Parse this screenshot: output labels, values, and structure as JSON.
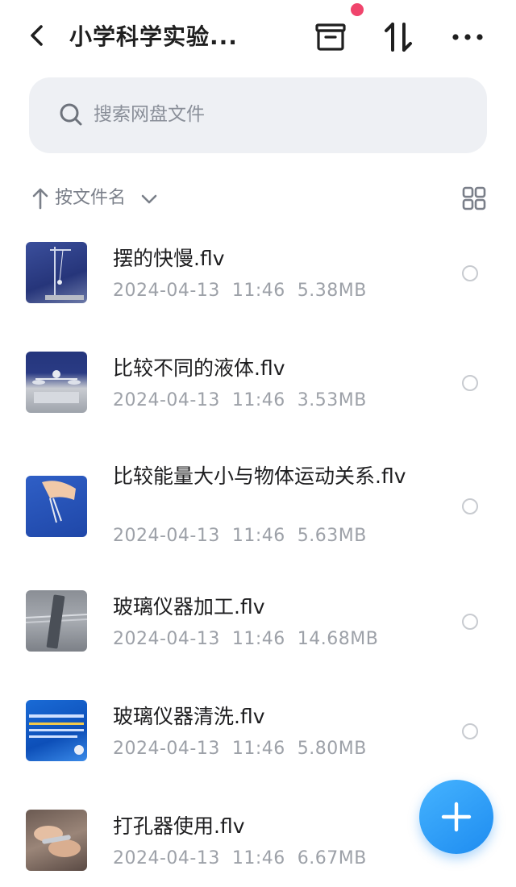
{
  "header": {
    "title": "小学科学实验...",
    "back_icon": "chevron-left-icon",
    "archive_icon": "archive-icon",
    "sort_icon": "sort-arrows-icon",
    "more_icon": "more-horizontal-icon",
    "badge_color": "#f0446c"
  },
  "search": {
    "placeholder": "搜索网盘文件"
  },
  "sort_bar": {
    "label": "按文件名",
    "view_icon": "grid-view-icon"
  },
  "files": [
    {
      "name": "摆的快慢.flv",
      "date": "2024-04-13",
      "time": "11:46",
      "size": "5.38MB"
    },
    {
      "name": "比较不同的液体.flv",
      "date": "2024-04-13",
      "time": "11:46",
      "size": "3.53MB"
    },
    {
      "name": "比较能量大小与物体运动关系.flv",
      "date": "2024-04-13",
      "time": "11:46",
      "size": "5.63MB"
    },
    {
      "name": "玻璃仪器加工.flv",
      "date": "2024-04-13",
      "time": "11:46",
      "size": "14.68MB"
    },
    {
      "name": "玻璃仪器清洗.flv",
      "date": "2024-04-13",
      "time": "11:46",
      "size": "5.80MB"
    },
    {
      "name": "打孔器使用.flv",
      "date": "2024-04-13",
      "time": "11:46",
      "size": "6.67MB"
    }
  ],
  "fab": {
    "icon": "plus-icon",
    "color": "#2b9cf5"
  }
}
